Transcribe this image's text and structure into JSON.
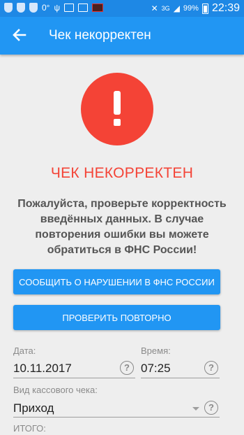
{
  "status_bar": {
    "temperature": "0°",
    "network": "3G",
    "battery": "99%",
    "time": "22:39",
    "icons": [
      "shield-icon",
      "shield-icon",
      "shield-icon",
      "usb-icon",
      "gallery-icon",
      "media-icon",
      "mute-icon",
      "signal-icon",
      "battery-icon"
    ]
  },
  "app_bar": {
    "title": "Чек некорректен",
    "back_icon": "arrow-back-icon"
  },
  "error": {
    "icon": "exclamation-circle-icon",
    "title": "ЧЕК НЕКОРРЕКТЕН",
    "message": "Пожалуйста, проверьте корректность введённых данных. В случае повторения ошибки вы можете обратиться в ФНС России!"
  },
  "buttons": {
    "report": "Сообщить о нарушении в ФНС России",
    "retry": "Проверить повторно"
  },
  "form": {
    "date_label": "Дата:",
    "date_value": "10.11.2017",
    "time_label": "Время:",
    "time_value": "07:25",
    "receipt_type_label": "Вид кассового чека:",
    "receipt_type_value": "Приход",
    "total_label": "ИТОГО:",
    "help_glyph": "?"
  },
  "colors": {
    "primary": "#2196f3",
    "status_bar": "#1e88e5",
    "error": "#f44336"
  }
}
